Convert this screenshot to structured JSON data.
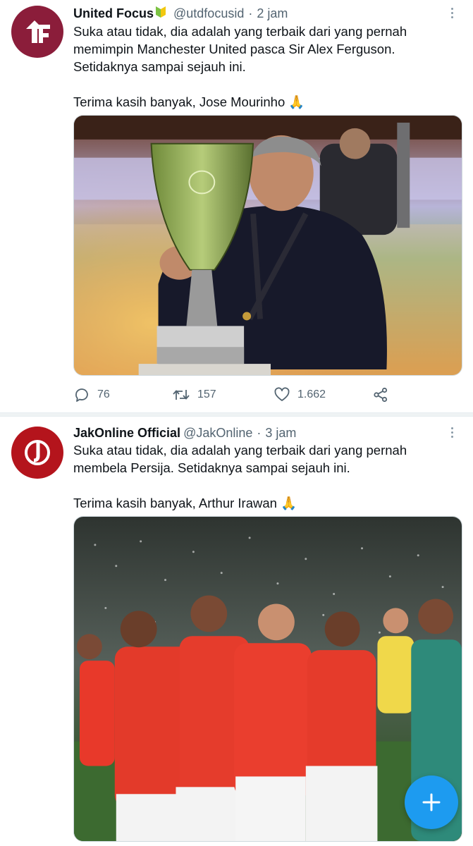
{
  "tweets": [
    {
      "display_name": "United Focus",
      "handle": "@utdfocusid",
      "separator": "·",
      "time": "2 jam",
      "avatar_icon": "uf-logo-icon",
      "badge_icon": "beginner-badge-icon",
      "lines": [
        "Suka atau tidak, dia adalah yang terbaik dari yang pernah",
        "memimpin Manchester United pasca Sir Alex Ferguson.",
        "Setidaknya sampai sejauh ini."
      ],
      "closing_line": "Terima kasih banyak, Jose Mourinho 🙏",
      "media_description": "photo-mourinho-trophy",
      "counts": {
        "replies": "76",
        "retweets": "157",
        "likes": "1.662"
      }
    },
    {
      "display_name": "JakOnline Official",
      "handle": "@JakOnline",
      "separator": "·",
      "time": "3 jam",
      "avatar_icon": "jo-logo-icon",
      "lines": [
        "Suka atau tidak, dia adalah yang terbaik dari yang pernah",
        "membela Persija. Setidaknya sampai sejauh ini."
      ],
      "closing_line": "Terima kasih banyak, Arthur Irawan 🙏",
      "media_description": "photo-persija-players"
    }
  ],
  "colors": {
    "accent": "#1d9bf0",
    "avatar_1": "#8b1d3a",
    "avatar_2": "#b4141c",
    "secondary_text": "#536471"
  },
  "compose_button_icon": "plus-icon"
}
